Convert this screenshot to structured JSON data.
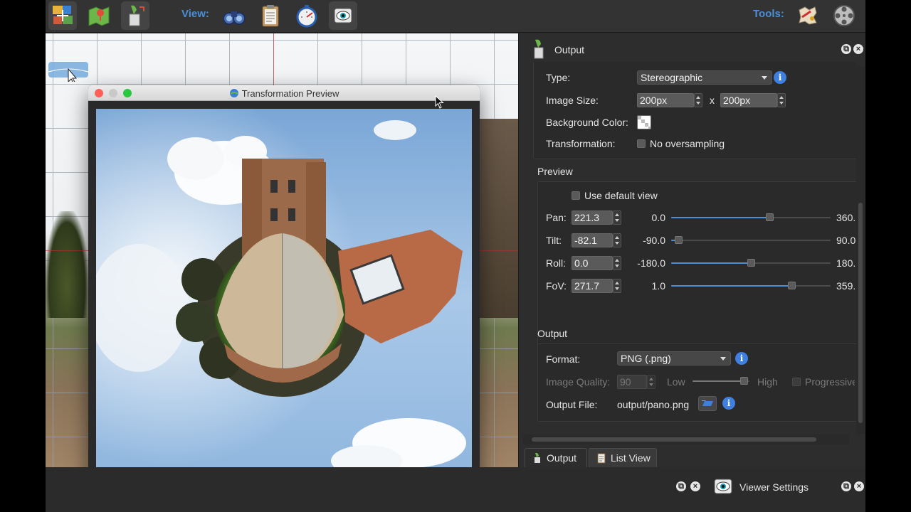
{
  "toolbar": {
    "view_label": "View:",
    "tools_label": "Tools:",
    "left_buttons": [
      "stitcher-tool-icon",
      "map-icon",
      "output-tool-icon"
    ],
    "view_buttons": [
      "binoculars-icon",
      "clipboard-icon",
      "stopwatch-icon",
      "eye-icon"
    ],
    "tools_buttons": [
      "paint-fx-icon",
      "film-reel-icon"
    ]
  },
  "preview_window": {
    "title": "Transformation Preview",
    "traffic_lights": {
      "close": "#fe5f57",
      "minimize": "#c9c9c9",
      "zoom": "#28c840"
    }
  },
  "output_panel": {
    "title": "Output",
    "type_label": "Type:",
    "type_value": "Stereographic",
    "image_size_label": "Image Size:",
    "width_value": "200px",
    "size_separator": "x",
    "height_value": "200px",
    "background_color_label": "Background Color:",
    "transformation_label": "Transformation:",
    "oversampling_label": "No oversampling",
    "preview_section": "Preview",
    "use_default_view_label": "Use default view",
    "params": [
      {
        "label": "Pan:",
        "value": "221.3",
        "min": "0.0",
        "max": "360.",
        "fraction": 0.6147
      },
      {
        "label": "Tilt:",
        "value": "-82.1",
        "min": "-90.0",
        "max": "90.0",
        "fraction": 0.0439
      },
      {
        "label": "Roll:",
        "value": "0.0",
        "min": "-180.0",
        "max": "180.",
        "fraction": 0.5
      },
      {
        "label": "FoV:",
        "value": "271.7",
        "min": "1.0",
        "max": "359.",
        "fraction": 0.7561
      }
    ],
    "output_section": "Output",
    "format_label": "Format:",
    "format_value": "PNG (.png)",
    "quality_label": "Image Quality:",
    "quality_value": "90",
    "quality_low": "Low",
    "quality_high": "High",
    "quality_fraction": 0.9,
    "progressive_label": "Progressive",
    "output_file_label": "Output File:",
    "output_file_value": "output/pano.png"
  },
  "tabs": [
    {
      "label": "Output",
      "active": true
    },
    {
      "label": "List View",
      "active": false
    }
  ],
  "viewer_dock": {
    "title": "Viewer Settings"
  },
  "colors": {
    "accent": "#4a8fd8",
    "info": "#3f7fe0",
    "panel": "#2d2d2d"
  }
}
